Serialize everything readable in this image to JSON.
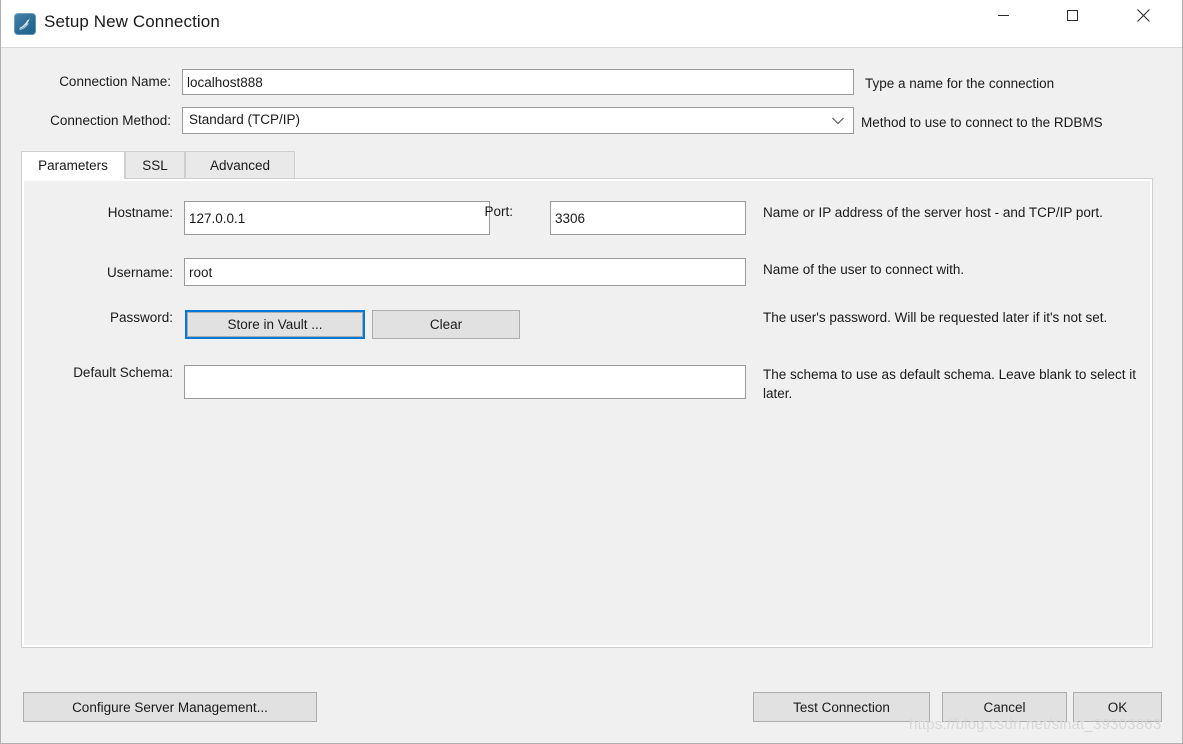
{
  "window": {
    "title": "Setup New Connection",
    "icon": "mysql-workbench-dolphin-icon",
    "controls": {
      "minimize": "minimize-icon",
      "maximize": "maximize-icon",
      "close": "close-icon"
    }
  },
  "form": {
    "connection_name": {
      "label": "Connection Name:",
      "value": "localhost888",
      "placeholder": "",
      "hint": "Type a name for the connection"
    },
    "connection_method": {
      "label": "Connection Method:",
      "value": "Standard (TCP/IP)",
      "hint": "Method to use to connect to the RDBMS",
      "arrow_icon": "chevron-down-icon"
    }
  },
  "tabs": [
    {
      "label": "Parameters",
      "active": true
    },
    {
      "label": "SSL",
      "active": false
    },
    {
      "label": "Advanced",
      "active": false
    }
  ],
  "parameters": {
    "hostname": {
      "label": "Hostname:",
      "value": "127.0.0.1",
      "placeholder": ""
    },
    "port": {
      "label": "Port:",
      "value": "3306",
      "placeholder": ""
    },
    "hostport_hint": "Name or IP address of the server host - and TCP/IP port.",
    "username": {
      "label": "Username:",
      "value": "root",
      "placeholder": "",
      "hint": "Name of the user to connect with."
    },
    "password": {
      "label": "Password:",
      "store_button": "Store in Vault ...",
      "clear_button": "Clear",
      "hint": "The user's password. Will be requested later if it's not set."
    },
    "default_schema": {
      "label": "Default Schema:",
      "value": "",
      "placeholder": "",
      "hint": "The schema to use as default schema. Leave blank to select it later."
    }
  },
  "footer": {
    "configure_server": "Configure Server Management...",
    "test_connection": "Test Connection",
    "cancel": "Cancel",
    "ok": "OK"
  },
  "watermark": "https://blog.csdn.net/sinat_39303863",
  "colors": {
    "focus_accent": "#0078d7",
    "window_bg": "#f0f0f0",
    "titlebar_bg": "#ffffff",
    "button_bg": "#e1e1e1",
    "field_border": "#9a9a9a"
  }
}
